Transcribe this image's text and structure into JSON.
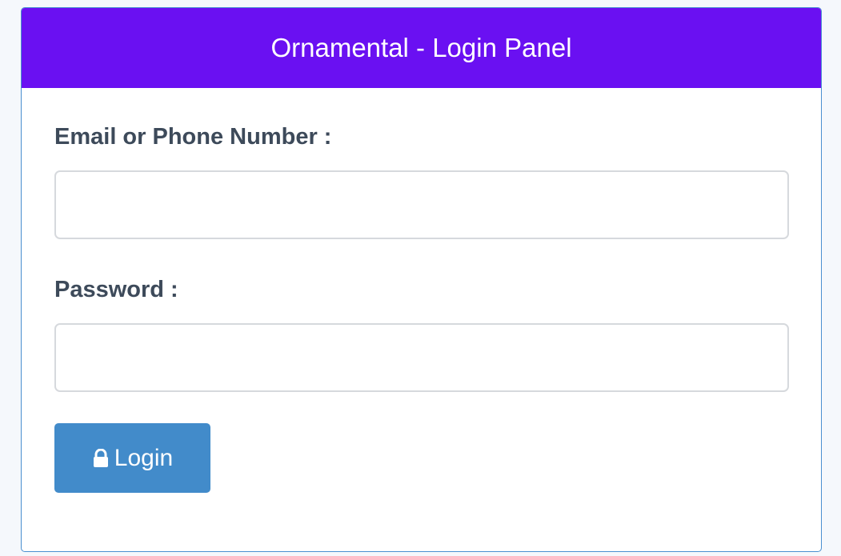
{
  "panel": {
    "title": "Ornamental - Login Panel",
    "header_color": "#6a10f2"
  },
  "form": {
    "email_label": "Email or Phone Number :",
    "email_value": "",
    "password_label": "Password :",
    "password_value": "",
    "login_label": "Login",
    "login_icon": "lock-icon",
    "button_color": "#428bca"
  }
}
